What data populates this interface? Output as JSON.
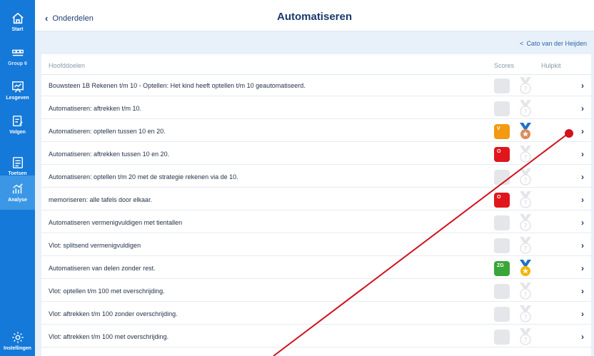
{
  "sidebar": {
    "items": [
      {
        "label": "Start",
        "icon": "home-icon"
      },
      {
        "label": "Group 6",
        "icon": "group-icon"
      },
      {
        "label": "Lesgeven",
        "icon": "lesgeven-icon"
      },
      {
        "label": "Volgen",
        "icon": "volgen-icon"
      },
      {
        "label": "Toetsen",
        "icon": "toetsen-icon"
      },
      {
        "label": "Analyse",
        "icon": "analyse-icon",
        "active": true
      },
      {
        "label": "Instellingen",
        "icon": "gear-icon"
      }
    ]
  },
  "header": {
    "back_label": "Onderdelen",
    "title": "Automatiseren"
  },
  "subheader": {
    "student_link": "Cato van der Heijden"
  },
  "table": {
    "columns": {
      "goals": "Hoofddoelen",
      "scores": "Scores",
      "help": "Hulpkit"
    },
    "rows": [
      {
        "label": "Bouwsteen 1B Rekenen t/m 10 - Optellen: Het kind heeft optellen t/m 10 geautomatiseerd.",
        "score": "",
        "score_color": "#e4e6e9",
        "medal": "locked"
      },
      {
        "label": "Automatiseren: aftrekken t/m 10.",
        "score": "",
        "score_color": "#e4e6e9",
        "medal": "locked"
      },
      {
        "label": "Automatiseren: optellen tussen 10 en 20.",
        "score": "V",
        "score_color": "#f39a12",
        "medal": "bronze"
      },
      {
        "label": "Automatiseren: aftrekken tussen 10 en 20.",
        "score": "O",
        "score_color": "#e0161c",
        "medal": "locked"
      },
      {
        "label": "Automatiseren: optellen t/m 20 met de strategie rekenen via de 10.",
        "score": "",
        "score_color": "#e4e6e9",
        "medal": "locked"
      },
      {
        "label": "memoriseren: alle tafels door elkaar.",
        "score": "O",
        "score_color": "#e0161c",
        "medal": "locked"
      },
      {
        "label": "Automatiseren vermenigvuldigen met tientallen",
        "score": "",
        "score_color": "#e4e6e9",
        "medal": "locked"
      },
      {
        "label": "Vlot: splitsend vermenigvuldigen",
        "score": "",
        "score_color": "#e4e6e9",
        "medal": "locked"
      },
      {
        "label": "Automatiseren van delen zonder rest.",
        "score": "ZG",
        "score_color": "#3aa63a",
        "medal": "gold"
      },
      {
        "label": "Vlot: optellen t/m 100 met overschrijding.",
        "score": "",
        "score_color": "#e4e6e9",
        "medal": "locked"
      },
      {
        "label": "Vlot: aftrekken t/m 100 zonder overschrijding.",
        "score": "",
        "score_color": "#e4e6e9",
        "medal": "locked"
      },
      {
        "label": "Vlot: aftrekken t/m 100 met overschrijding.",
        "score": "",
        "score_color": "#e4e6e9",
        "medal": "locked"
      }
    ]
  },
  "colors": {
    "sidebar": "#1479d8",
    "annotation": "#d1121f"
  }
}
